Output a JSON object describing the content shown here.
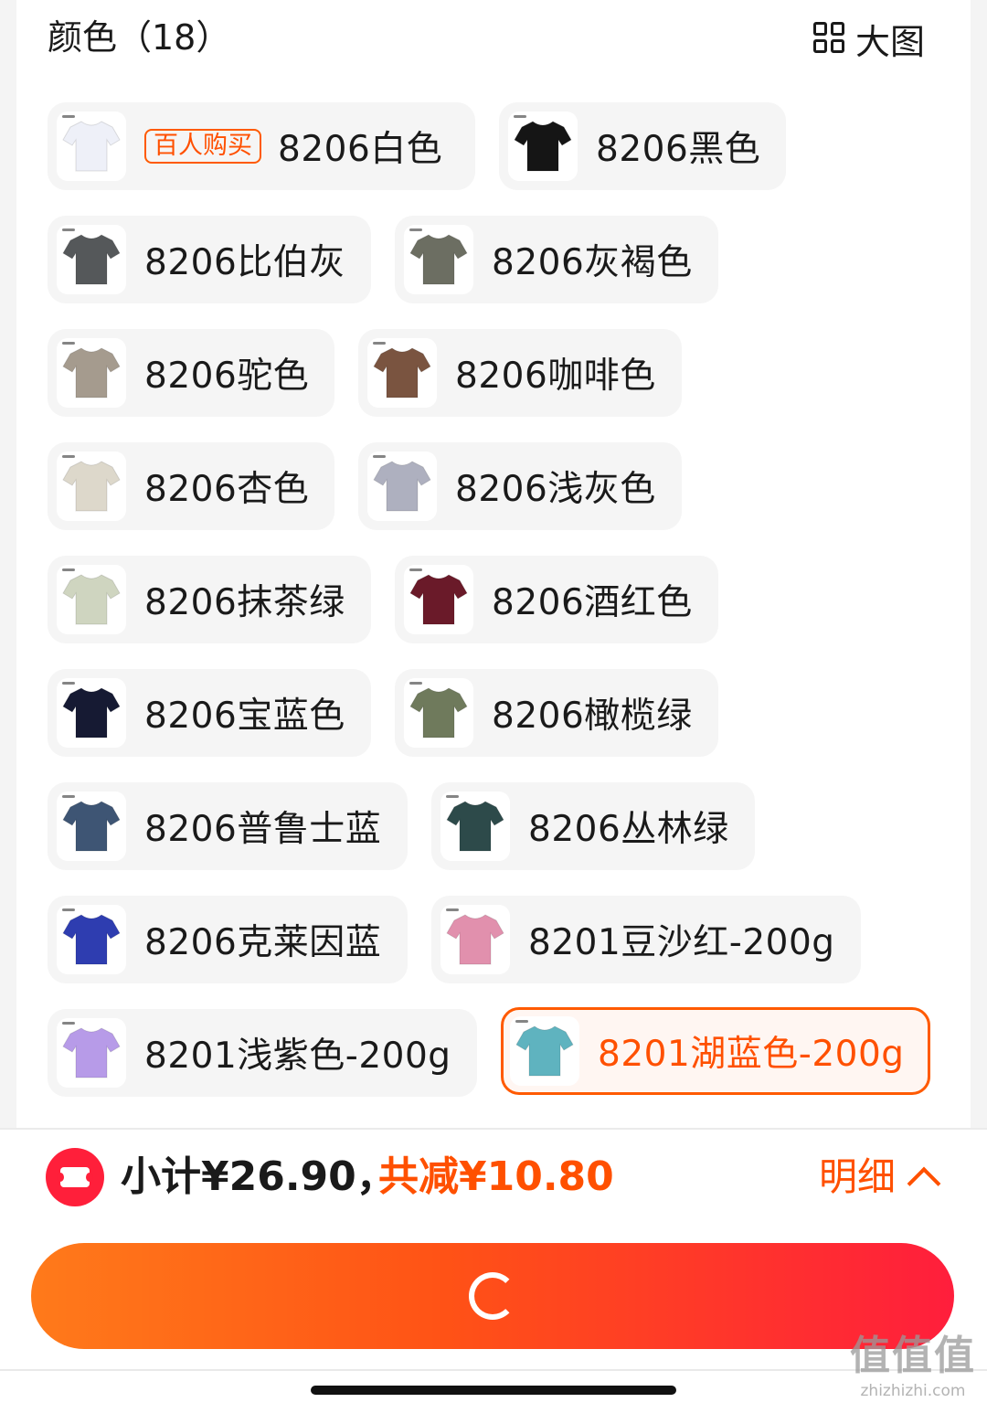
{
  "header": {
    "title": "颜色（18）",
    "big_view_label": "大图"
  },
  "colors": [
    {
      "label": "8206白色",
      "badge": "百人购买",
      "swatch": "#eef0f8"
    },
    {
      "label": "8206黑色",
      "swatch": "#151515"
    },
    {
      "label": "8206比伯灰",
      "swatch": "#55585a"
    },
    {
      "label": "8206灰褐色",
      "swatch": "#6c6e62"
    },
    {
      "label": "8206驼色",
      "swatch": "#a59b8e"
    },
    {
      "label": "8206咖啡色",
      "swatch": "#7a5440"
    },
    {
      "label": "8206杏色",
      "swatch": "#ddd8cb"
    },
    {
      "label": "8206浅灰色",
      "swatch": "#aeb0bf"
    },
    {
      "label": "8206抹茶绿",
      "swatch": "#cfd5c0"
    },
    {
      "label": "8206酒红色",
      "swatch": "#6a1a29"
    },
    {
      "label": "8206宝蓝色",
      "swatch": "#161a33"
    },
    {
      "label": "8206橄榄绿",
      "swatch": "#6f7a5c"
    },
    {
      "label": "8206普鲁士蓝",
      "swatch": "#3e5574"
    },
    {
      "label": "8206丛林绿",
      "swatch": "#2d4a4a"
    },
    {
      "label": "8206克莱因蓝",
      "swatch": "#2e3db0"
    },
    {
      "label": "8201豆沙红-200g",
      "swatch": "#e190ad"
    },
    {
      "label": "8201浅紫色-200g",
      "swatch": "#b79be8"
    },
    {
      "label": "8201湖蓝色-200g",
      "swatch": "#5fb3bf",
      "selected": true
    }
  ],
  "footer": {
    "subtotal": "小计¥26.90，",
    "discount": "共减¥10.80",
    "detail_label": "明细"
  },
  "accent_color": "#ff5000",
  "watermark": {
    "logo": "值值值",
    "url": "zhizhizhi.com"
  }
}
